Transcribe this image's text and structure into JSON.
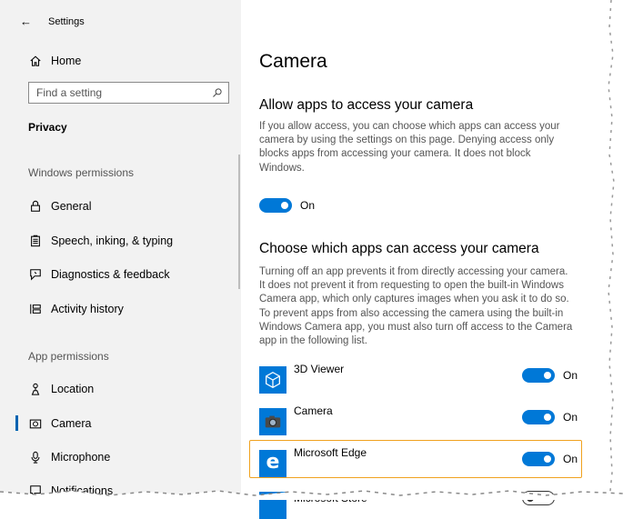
{
  "header": {
    "back_icon": "back-arrow-icon",
    "title": "Settings"
  },
  "sidebar": {
    "home": {
      "label": "Home",
      "icon": "home-icon"
    },
    "search": {
      "placeholder": "Find a setting",
      "icon": "search-icon"
    },
    "current_section": "Privacy",
    "windows_permissions_heading": "Windows permissions",
    "windows_permissions": [
      {
        "label": "General",
        "icon": "lock-icon"
      },
      {
        "label": "Speech, inking, & typing",
        "icon": "clipboard-icon"
      },
      {
        "label": "Diagnostics & feedback",
        "icon": "feedback-icon"
      },
      {
        "label": "Activity history",
        "icon": "timeline-icon"
      }
    ],
    "app_permissions_heading": "App permissions",
    "app_permissions": [
      {
        "label": "Location",
        "icon": "location-icon"
      },
      {
        "label": "Camera",
        "icon": "camera-icon",
        "active": true
      },
      {
        "label": "Microphone",
        "icon": "microphone-icon"
      },
      {
        "label": "Notifications",
        "icon": "notifications-icon"
      }
    ]
  },
  "main": {
    "title": "Camera",
    "allow": {
      "heading": "Allow apps to access your camera",
      "description": "If you allow access, you can choose which apps can access your camera by using the settings on this page. Denying access only blocks apps from accessing your camera. It does not block Windows.",
      "toggle_label": "On",
      "toggle_on": true
    },
    "choose": {
      "heading": "Choose which apps can access your camera",
      "description": "Turning off an app prevents it from directly accessing your camera. It does not prevent it from requesting to open the built-in Windows Camera app, which only captures images when you ask it to do so. To prevent apps from also accessing the camera using the built-in Windows Camera app, you must also turn off access to the Camera app in the following list."
    },
    "apps": [
      {
        "name": "3D Viewer",
        "toggle_label": "On",
        "on": true,
        "icon": "3d-viewer-icon",
        "icon_color": "#0078d7"
      },
      {
        "name": "Camera",
        "toggle_label": "On",
        "on": true,
        "icon": "camera-app-icon",
        "icon_color": "#0078d7"
      },
      {
        "name": "Microsoft Edge",
        "toggle_label": "On",
        "on": true,
        "icon": "edge-icon",
        "icon_color": "#0078d7",
        "highlighted": true
      },
      {
        "name": "Microsoft Store",
        "on": false,
        "icon": "store-icon",
        "icon_color": "#0078d7"
      }
    ]
  },
  "colors": {
    "accent": "#0078d7",
    "highlight": "#f0a21f",
    "sidebar_bg": "#f2f2f2"
  }
}
